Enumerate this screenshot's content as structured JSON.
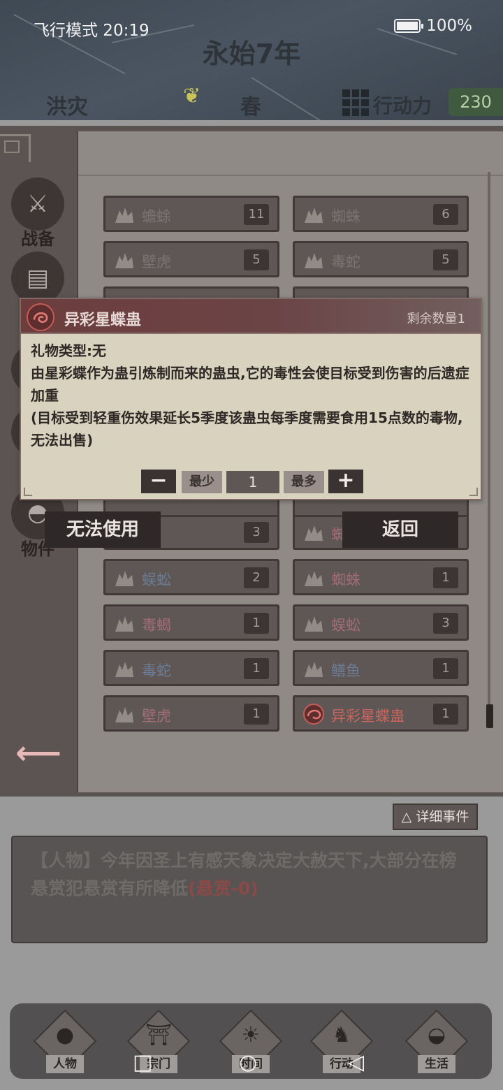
{
  "status_bar": {
    "left": "飞行模式 20:19",
    "battery": "100%"
  },
  "header": {
    "year": "永始7年",
    "disaster": "洪灾",
    "season": "春",
    "action_label": "行动力",
    "action_value": "230"
  },
  "sidebar": [
    {
      "label": "战备",
      "icon": "sword-shield-icon"
    },
    {
      "label": "",
      "icon": "book-icon"
    },
    {
      "label": "物件",
      "icon": "bag-icon"
    }
  ],
  "grid": {
    "rows": [
      [
        {
          "name": "蟾蜍",
          "count": "11",
          "tone": "gray"
        },
        {
          "name": "蜘蛛",
          "count": "6",
          "tone": "gray"
        }
      ],
      [
        {
          "name": "壁虎",
          "count": "5",
          "tone": "gray"
        },
        {
          "name": "毒蛇",
          "count": "5",
          "tone": "gray"
        }
      ],
      [
        {
          "name": "蛇",
          "count": "3",
          "tone": "red"
        },
        {
          "name": "蜘",
          "count": "",
          "tone": "red"
        }
      ],
      [
        {
          "name": "蜈蚣",
          "count": "2",
          "tone": "blue"
        },
        {
          "name": "蜘蛛",
          "count": "1",
          "tone": "red"
        }
      ],
      [
        {
          "name": "毒蝎",
          "count": "1",
          "tone": "red"
        },
        {
          "name": "蜈蚣",
          "count": "3",
          "tone": "red"
        }
      ],
      [
        {
          "name": "毒蛇",
          "count": "1",
          "tone": "blue"
        },
        {
          "name": "鳝鱼",
          "count": "1",
          "tone": "blue"
        }
      ],
      [
        {
          "name": "壁虎",
          "count": "1",
          "tone": "red"
        },
        {
          "name": "异彩星蝶蛊",
          "count": "1",
          "tone": "hl"
        }
      ]
    ]
  },
  "tooltip": {
    "title": "异彩星蝶蛊",
    "remaining": "剩余数量1",
    "line1": "礼物类型:无",
    "line2": "由星彩蝶作为蛊引炼制而来的蛊虫,它的毒性会使目标受到伤害的后遗症加重",
    "line3": "(目标受到轻重伤效果延长5季度该蛊虫每季度需要食用15点数的毒物,无法出售)",
    "minus": "−",
    "min_label": "最少",
    "quantity": "1",
    "max_label": "最多",
    "plus": "+"
  },
  "actions": {
    "unusable": "无法使用",
    "back": "返回"
  },
  "detail_button": "△ 详细事件",
  "event": {
    "text": "【人物】今年因圣上有感天象决定大赦天下,大部分在榜悬赏犯悬赏有所降低",
    "reward": "(悬赏-0)"
  },
  "bottom_nav": [
    {
      "label": "人物",
      "icon": "person-icon"
    },
    {
      "label": "宗门",
      "icon": "gate-icon"
    },
    {
      "label": "时间",
      "icon": "sun-icon"
    },
    {
      "label": "行动",
      "icon": "run-icon"
    },
    {
      "label": "生活",
      "icon": "landscape-icon"
    }
  ],
  "system_nav": {
    "square": "□",
    "circle": "○",
    "triangle": "◁"
  },
  "colors": {
    "accent_red": "#c9655c",
    "header_bg": "#4a5561",
    "tooltip_bg": "#d9d2bf",
    "action_bg": "#3f5a3f"
  }
}
